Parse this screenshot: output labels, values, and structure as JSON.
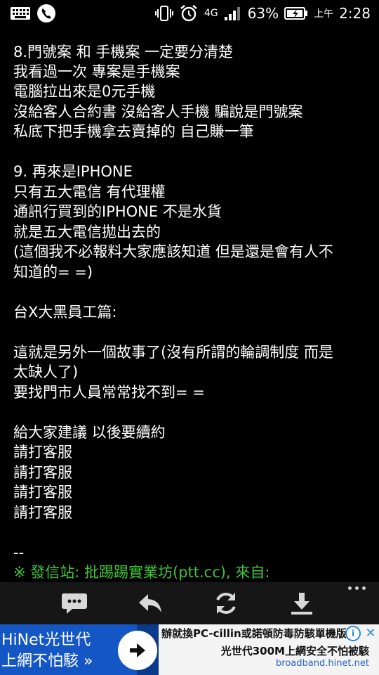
{
  "status_bar": {
    "battery_percent": "63%",
    "network_label": "4G",
    "time_prefix": "上午",
    "time": "2:28",
    "icons": [
      "keyboard-icon",
      "phone-call-icon",
      "vibrate-icon",
      "alarm-icon",
      "signal-icon",
      "battery-charging-icon"
    ]
  },
  "article": {
    "lines": [
      "8.門號案 和 手機案 一定要分清楚",
      "我看過一次 專案是手機案",
      "電腦拉出來是0元手機",
      "沒給客人合約書 沒給客人手機 騙說是門號案",
      "私底下把手機拿去賣掉的 自己賺一筆",
      "",
      "9. 再來是IPHONE",
      "只有五大電信 有代理權",
      "通訊行買到的IPHONE 不是水貨",
      "就是五大電信拋出去的",
      "(這個我不必報料大家應該知道 但是還是會有人不",
      "知道的= =)",
      "",
      "台X大黑員工篇:",
      "",
      "這就是另外一個故事了(沒有所謂的輪調制度 而是",
      "太缺人了)",
      "要找門市人員常常找不到= =",
      "",
      "給大家建議 以後要續約",
      "請打客服",
      "請打客服",
      "請打客服",
      "請打客服",
      "",
      "--"
    ],
    "signature": "※ 發信站: 批踢踢實業坊(ptt.cc), 來自:"
  },
  "toolbar": {
    "buttons": [
      "comment-icon",
      "reply-icon",
      "refresh-icon",
      "download-icon"
    ],
    "more": "more-options-icon"
  },
  "ad": {
    "left_line1": "HiNet光世代",
    "left_line2": "上網不怕駭 »",
    "right_line1": "辦就換PC-cillin或諾頓防毒防駭單機版",
    "right_line2": "光世代300M上網安全不怕被駭",
    "right_line3": "broadband.hinet.net",
    "info_label": "i",
    "close_label": "✕"
  }
}
